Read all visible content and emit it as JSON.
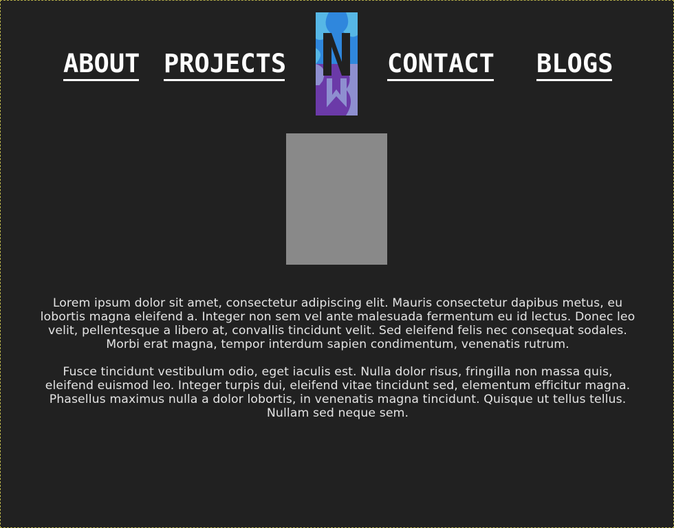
{
  "nav": {
    "about": "ABOUT",
    "projects": "PROJECTS",
    "contact": "CONTACT",
    "blogs": "BLOGS"
  },
  "logo": {
    "icon": "n-logo-icon",
    "colors": {
      "light_blue": "#56b7e6",
      "blue": "#2f87dd",
      "purple": "#6b3aa8",
      "lavender": "#8e8fd0"
    }
  },
  "image": {
    "color": "#898989"
  },
  "content": {
    "paragraphs": [
      "Lorem ipsum dolor sit amet, consectetur adipiscing elit. Mauris consectetur dapibus metus, eu lobortis magna eleifend a. Integer non sem vel ante malesuada fermentum eu id lectus. Donec leo velit, pellentesque a libero at, convallis tincidunt velit. Sed eleifend felis nec consequat sodales. Morbi erat magna, tempor interdum sapien condimentum, venenatis rutrum.",
      "Fusce tincidunt vestibulum odio, eget iaculis est. Nulla dolor risus, fringilla non massa quis, eleifend euismod leo. Integer turpis dui, eleifend vitae tincidunt sed, elementum efficitur magna. Phasellus maximus nulla a dolor lobortis, in venenatis magna tincidunt. Quisque ut tellus tellus. Nullam sed neque sem."
    ]
  },
  "colors": {
    "background": "#212121",
    "text": "#e3e3e3",
    "nav_text": "#ffffff"
  }
}
